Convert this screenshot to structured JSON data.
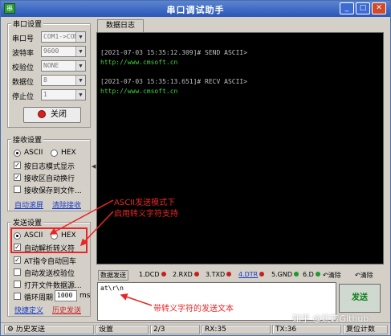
{
  "window": {
    "title": "串口调试助手",
    "app_icon": "串",
    "minimize": "_",
    "maximize": "□",
    "close": "✕"
  },
  "serial": {
    "group_title": "串口设置",
    "port_label": "串口号",
    "port_value": "COM1->COM",
    "baud_label": "波特率",
    "baud_value": "9600",
    "parity_label": "校验位",
    "parity_value": "NONE",
    "databits_label": "数据位",
    "databits_value": "8",
    "stopbits_label": "停止位",
    "stopbits_value": "1",
    "close_button": "关闭"
  },
  "receive": {
    "group_title": "接收设置",
    "ascii": "ASCII",
    "hex": "HEX",
    "opt1": "按日志模式显示",
    "opt2": "接收区自动换行",
    "opt3": "接收保存到文件...",
    "auto_clear": "自动滚屏",
    "clear_recv": "清除接收"
  },
  "send": {
    "group_title": "发送设置",
    "ascii": "ASCII",
    "hex": "HEX",
    "opt1": "自动解析转义符",
    "opt2": "AT指令自动回车",
    "opt3": "自动发送校验位",
    "opt4": "打开文件数据源...",
    "opt5": "循环周期",
    "period_value": "1000",
    "period_unit": "ms",
    "shortcut": "快捷定义",
    "history": "历史发送"
  },
  "log": {
    "tab": "数据日志",
    "lines": [
      {
        "text": "[2021-07-03 15:35:12.309]# SEND ASCII>",
        "color": "#bdbdbd"
      },
      {
        "text": "http://www.cmsoft.cn",
        "color": "#3ed33e"
      },
      {
        "text": "[2021-07-03 15:35:13.651]# RECV ASCII>",
        "color": "#bdbdbd"
      },
      {
        "text": "http://www.cmsoft.cn",
        "color": "#3ed33e"
      }
    ]
  },
  "sendbar": {
    "tab": "数据发送",
    "signals": [
      {
        "label": "1.DCD",
        "color": "#c81e1e"
      },
      {
        "label": "2.RXD",
        "color": "#c81e1e"
      },
      {
        "label": "3.TXD",
        "color": "#c81e1e"
      },
      {
        "label": "4.DTR",
        "color": "#c81e1e"
      },
      {
        "label": "5.GND",
        "color": "#1f9a2a"
      },
      {
        "label": "6.D",
        "color": "#1f9a2a"
      }
    ],
    "clear1": "清除",
    "clear2": "清除",
    "input_value": "at\\r\\n",
    "send_button": "发送"
  },
  "status": {
    "history": "历史发送",
    "settings": "设置",
    "page": "2/3",
    "rx": "RX:35",
    "tx": "TX:36",
    "reset": "复位计数"
  },
  "annotations": {
    "note1_line1": "ASCII发送模式下",
    "note1_line2": "启用转义字符支持",
    "note2": "带转义字符的发送文本"
  },
  "watermark": "知乎 @玩转Github",
  "colors": {
    "annotation": "#e82626",
    "log_bg": "#000000",
    "log_green": "#3ed33e"
  }
}
